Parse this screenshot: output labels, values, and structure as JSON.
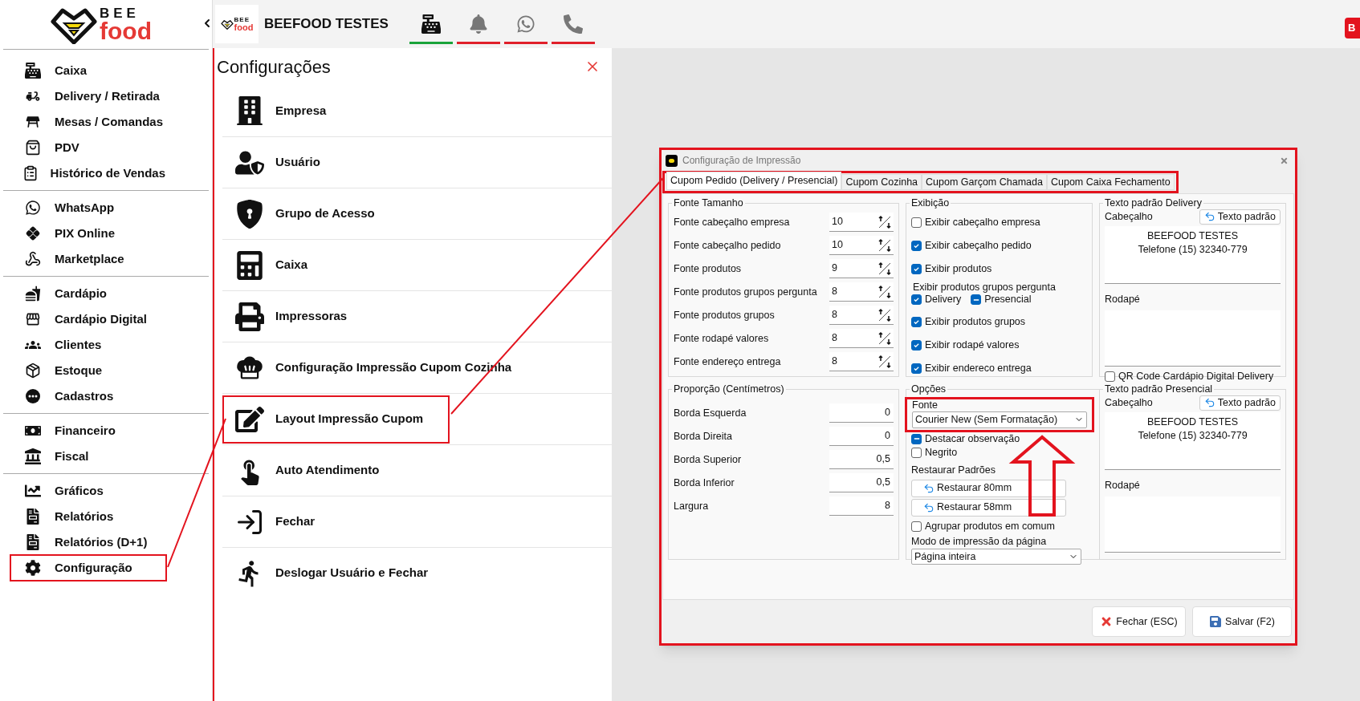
{
  "sidebar": {
    "logo": {
      "top": "BEE",
      "bottom": "food"
    },
    "groups": [
      [
        {
          "label": "Caixa",
          "highlighted": false
        },
        {
          "label": "Delivery / Retirada",
          "highlighted": false
        },
        {
          "label": "Mesas / Comandas",
          "highlighted": false
        },
        {
          "label": "PDV",
          "highlighted": false
        },
        {
          "label": "Histórico de Vendas",
          "highlighted": false
        }
      ],
      [
        {
          "label": "WhatsApp",
          "highlighted": false
        },
        {
          "label": "PIX Online",
          "highlighted": false
        },
        {
          "label": "Marketplace",
          "highlighted": false
        }
      ],
      [
        {
          "label": "Cardápio",
          "highlighted": false
        },
        {
          "label": "Cardápio Digital",
          "highlighted": false
        },
        {
          "label": "Clientes",
          "highlighted": false
        },
        {
          "label": "Estoque",
          "highlighted": false
        },
        {
          "label": "Cadastros",
          "highlighted": false
        }
      ],
      [
        {
          "label": "Financeiro",
          "highlighted": false
        },
        {
          "label": "Fiscal",
          "highlighted": false
        }
      ],
      [
        {
          "label": "Gráficos",
          "highlighted": false
        },
        {
          "label": "Relatórios",
          "highlighted": false
        },
        {
          "label": "Relatórios (D+1)",
          "highlighted": false
        },
        {
          "label": "Configuração",
          "highlighted": true
        }
      ]
    ]
  },
  "top_bar": {
    "logo": {
      "top": "BEE",
      "bottom": "food"
    },
    "company": "BEEFOOD TESTES",
    "nav": [
      {
        "selected": true
      },
      {
        "selected": false
      },
      {
        "selected": false
      },
      {
        "selected": false
      }
    ],
    "corner_button": "B"
  },
  "settings_panel": {
    "title": "Configurações",
    "items": [
      {
        "label": "Empresa",
        "highlighted": false
      },
      {
        "label": "Usuário",
        "highlighted": false
      },
      {
        "label": "Grupo de Acesso",
        "highlighted": false
      },
      {
        "label": "Caixa",
        "highlighted": false
      },
      {
        "label": "Impressoras",
        "highlighted": false
      },
      {
        "label": "Configuração Impressão Cupom Cozinha",
        "highlighted": false
      },
      {
        "label": "Layout Impressão Cupom",
        "highlighted": true
      },
      {
        "label": "Auto Atendimento",
        "highlighted": false
      },
      {
        "label": "Fechar",
        "highlighted": false
      },
      {
        "label": "Deslogar Usuário e Fechar",
        "highlighted": false
      }
    ]
  },
  "dialog": {
    "title": "Configuração de Impressão",
    "tabs_highlighted": true,
    "tabs": [
      {
        "label": "Cupom Pedido (Delivery / Presencial)",
        "selected": true
      },
      {
        "label": "Cupom Cozinha",
        "selected": false
      },
      {
        "label": "Cupom Garçom Chamada",
        "selected": false
      },
      {
        "label": "Cupom Caixa Fechamento",
        "selected": false
      }
    ],
    "font_size": {
      "title": "Fonte Tamanho",
      "rows": [
        {
          "label": "Fonte cabeçalho empresa",
          "value": "10"
        },
        {
          "label": "Fonte cabeçalho pedido",
          "value": "10"
        },
        {
          "label": "Fonte produtos",
          "value": "9"
        },
        {
          "label": "Fonte produtos grupos pergunta",
          "value": "8"
        },
        {
          "label": "Fonte produtos grupos",
          "value": "8"
        },
        {
          "label": "Fonte rodapé valores",
          "value": "8"
        },
        {
          "label": "Fonte endereço entrega",
          "value": "8"
        }
      ]
    },
    "proportion": {
      "title": "Proporção (Centímetros)",
      "rows": [
        {
          "label": "Borda Esquerda",
          "value": "0"
        },
        {
          "label": "Borda Direita",
          "value": "0"
        },
        {
          "label": "Borda Superior",
          "value": "0,5"
        },
        {
          "label": "Borda Inferior",
          "value": "0,5"
        },
        {
          "label": "Largura",
          "value": "8"
        }
      ]
    },
    "display": {
      "title": "Exibição",
      "items": [
        {
          "kind": "checkbox",
          "label": "Exibir cabeçalho empresa",
          "checked": false
        },
        {
          "kind": "checkbox",
          "label": "Exibir cabeçalho pedido",
          "checked": true
        },
        {
          "kind": "checkbox",
          "label": "Exibir produtos",
          "checked": true
        },
        {
          "kind": "heading",
          "label": "Exibir produtos grupos pergunta"
        },
        {
          "kind": "pair",
          "items": [
            {
              "kind": "tick",
              "label": "Delivery",
              "checked": true
            },
            {
              "kind": "minus",
              "label": "Presencial",
              "checked": true
            }
          ]
        },
        {
          "kind": "checkbox",
          "label": "Exibir produtos grupos",
          "checked": true
        },
        {
          "kind": "checkbox",
          "label": "Exibir rodapé valores",
          "checked": true
        },
        {
          "kind": "checkbox",
          "label": "Exibir endereco entrega",
          "checked": true
        }
      ]
    },
    "options": {
      "title": "Opções",
      "font_label": "Fonte",
      "font_value": "Courier New (Sem Formatação)",
      "font_highlighted": true,
      "checks": [
        {
          "kind": "minus",
          "label": "Destacar observação",
          "checked": true
        },
        {
          "label": "Negrito",
          "checked": false
        }
      ],
      "restore_label": "Restaurar Padrões",
      "restore_buttons": [
        "Restaurar 80mm",
        "Restaurar 58mm"
      ],
      "group_check": {
        "label": "Agrupar produtos em comum",
        "checked": false
      },
      "mode_label": "Modo de impressão da página",
      "mode_value": "Página inteira"
    },
    "text_groups": [
      {
        "title": "Texto padrão Delivery",
        "header_label": "Cabeçalho",
        "button": "Texto padrão",
        "header_lines": [
          "BEEFOOD TESTES",
          "Telefone (15) 32340-779"
        ],
        "footer_label": "Rodapé",
        "qr": {
          "label": "QR Code Cardápio Digital Delivery",
          "checked": false
        }
      },
      {
        "title": "Texto padrão Presencial",
        "header_label": "Cabeçalho",
        "button": "Texto padrão",
        "header_lines": [
          "BEEFOOD TESTES",
          "Telefone (15) 32340-779"
        ],
        "footer_label": "Rodapé"
      }
    ],
    "buttons": [
      {
        "kind": "close",
        "label": "Fechar (ESC)"
      },
      {
        "kind": "save",
        "label": "Salvar (F2)"
      }
    ]
  }
}
